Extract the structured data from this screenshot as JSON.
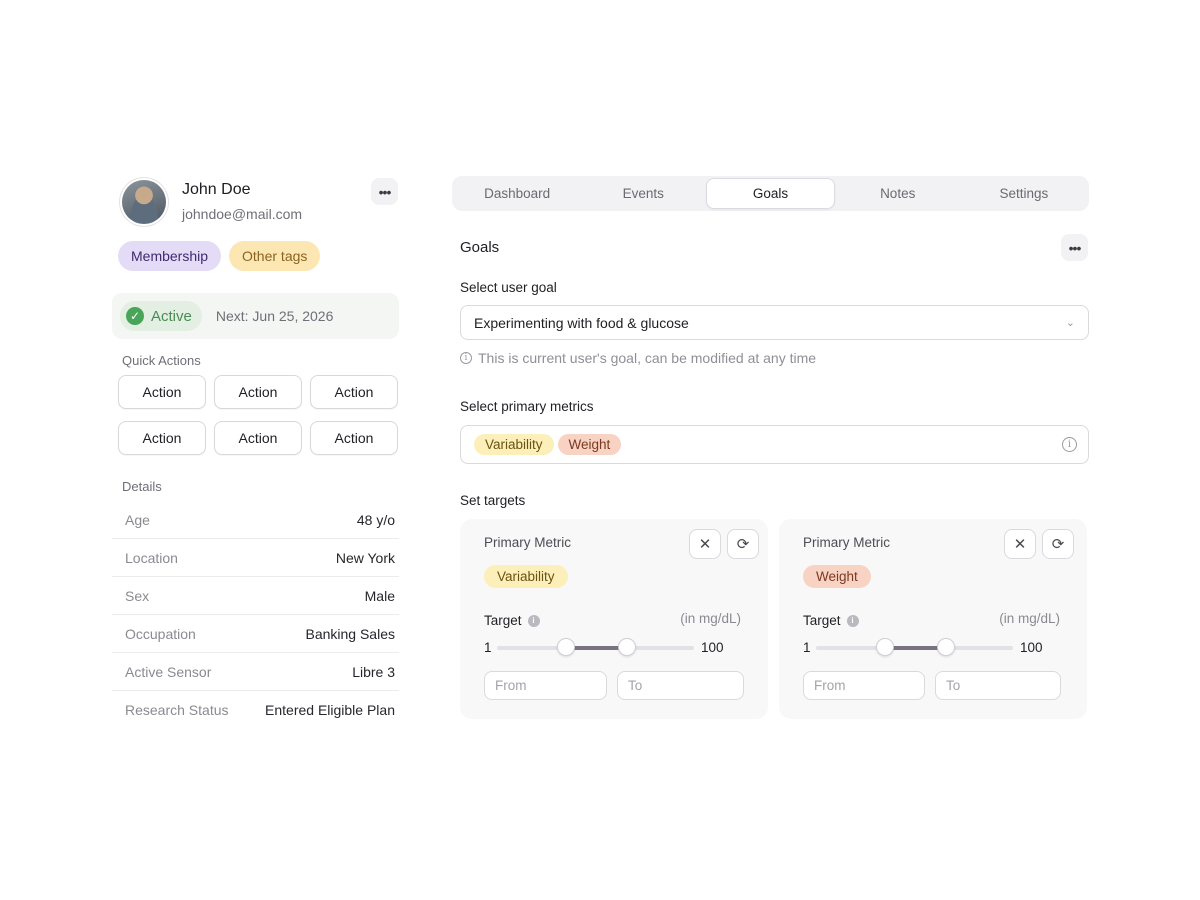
{
  "profile": {
    "name": "John Doe",
    "email": "johndoe@mail.com",
    "more_icon": "ellipsis-icon"
  },
  "tags": [
    {
      "label": "Membership",
      "color": "#e4dcf6"
    },
    {
      "label": "Other tags",
      "color": "#fce7b3"
    }
  ],
  "status": {
    "label": "Active",
    "next": "Next: Jun 25, 2026",
    "color": "#4aa55a"
  },
  "quick_actions": {
    "label": "Quick Actions",
    "buttons": [
      "Action",
      "Action",
      "Action",
      "Action",
      "Action",
      "Action"
    ]
  },
  "details": {
    "label": "Details",
    "rows": [
      {
        "key": "Age",
        "value": "48 y/o"
      },
      {
        "key": "Location",
        "value": "New York"
      },
      {
        "key": "Sex",
        "value": "Male"
      },
      {
        "key": "Occupation",
        "value": "Banking Sales"
      },
      {
        "key": "Active Sensor",
        "value": "Libre 3"
      },
      {
        "key": "Research Status",
        "value": "Entered Eligible Plan"
      }
    ]
  },
  "tabs": [
    {
      "label": "Dashboard",
      "active": false
    },
    {
      "label": "Events",
      "active": false
    },
    {
      "label": "Goals",
      "active": true
    },
    {
      "label": "Notes",
      "active": false
    },
    {
      "label": "Settings",
      "active": false
    }
  ],
  "goals": {
    "title": "Goals",
    "select_goal_label": "Select user goal",
    "selected_goal": "Experimenting with food & glucose",
    "hint": "This is current user's goal, can be modified at any time",
    "metrics_label": "Select primary metrics",
    "metrics": [
      {
        "label": "Variability",
        "color": "#fcefb9"
      },
      {
        "label": "Weight",
        "color": "#f8d2c2"
      }
    ],
    "targets_label": "Set targets",
    "cards": [
      {
        "title": "Primary Metric",
        "metric": "Variability",
        "metric_color": "#fcefb9",
        "target_label": "Target",
        "unit": "(in mg/dL)",
        "min": "1",
        "max": "100",
        "range_low": 35,
        "range_high": 66,
        "from_placeholder": "From",
        "to_placeholder": "To"
      },
      {
        "title": "Primary Metric",
        "metric": "Weight",
        "metric_color": "#f8d2c2",
        "target_label": "Target",
        "unit": "(in mg/dL)",
        "min": "1",
        "max": "100",
        "range_low": 35,
        "range_high": 66,
        "from_placeholder": "From",
        "to_placeholder": "To"
      }
    ]
  }
}
